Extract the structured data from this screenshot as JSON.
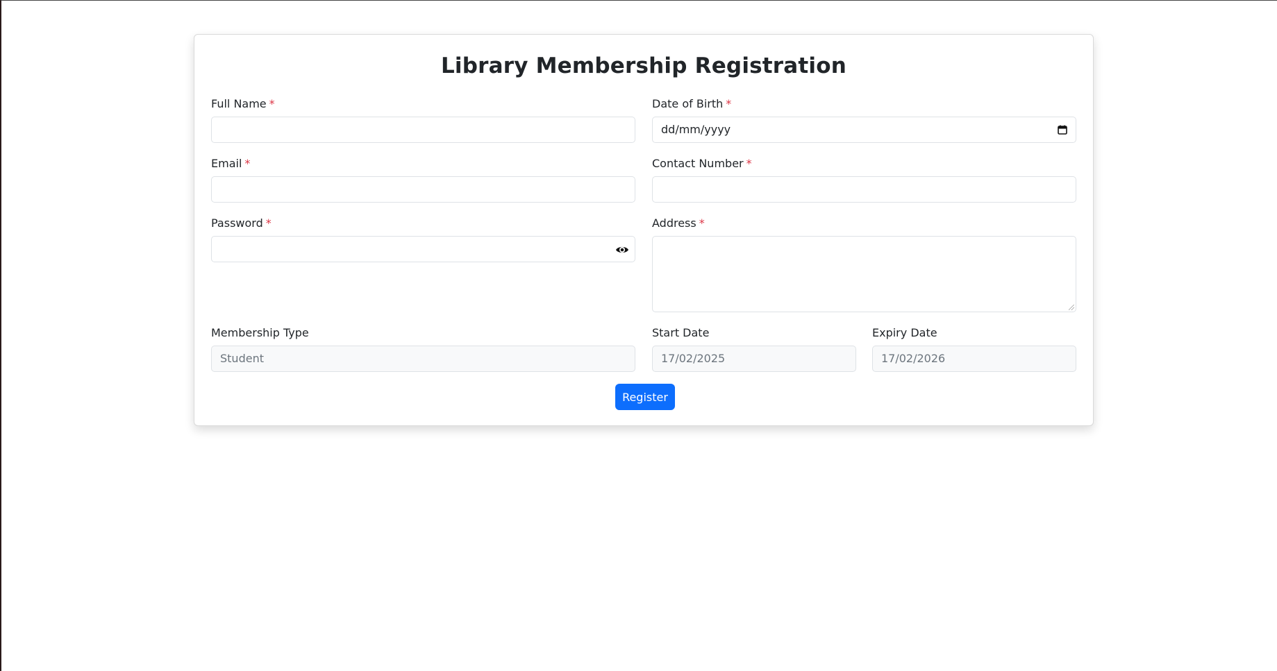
{
  "form": {
    "title": "Library Membership Registration",
    "required_marker": "*",
    "full_name": {
      "label": "Full Name",
      "value": ""
    },
    "date_of_birth": {
      "label": "Date of Birth",
      "placeholder": "dd/mm/yyyy"
    },
    "email": {
      "label": "Email",
      "value": ""
    },
    "contact_number": {
      "label": "Contact Number",
      "value": ""
    },
    "password": {
      "label": "Password",
      "value": ""
    },
    "address": {
      "label": "Address",
      "value": ""
    },
    "membership_type": {
      "label": "Membership Type",
      "value": "Student"
    },
    "start_date": {
      "label": "Start Date",
      "value": "17/02/2025"
    },
    "expiry_date": {
      "label": "Expiry Date",
      "value": "17/02/2026"
    },
    "register_label": "Register"
  },
  "icons": {
    "calendar": "calendar-icon",
    "password_toggle": "eye-icon"
  },
  "colors": {
    "primary": "#0d6efd",
    "required": "#dc3545",
    "readonly_bg": "#f8f9fa"
  }
}
